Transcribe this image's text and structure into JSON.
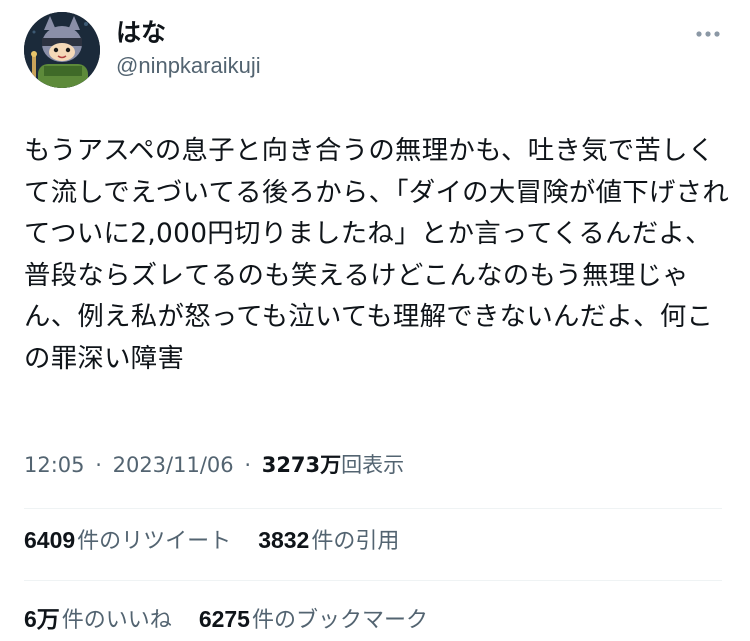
{
  "user": {
    "display_name": "はな",
    "handle": "@ninpkaraikuji",
    "avatar_icon": "cartoon-cat-ninja-avatar"
  },
  "more_icon": "ellipsis-icon",
  "tweet": {
    "text": "もうアスペの息子と向き合うの無理かも、吐き気で苦しくて流しでえづいてる後ろから、「ダイの大冒険が値下げされてついに2,000円切りましたね」とか言ってくるんだよ、普段ならズレてるのも笑えるけどこんなのもう無理じゃん、例え私が怒っても泣いても理解できないんだよ、何この罪深い障害"
  },
  "meta": {
    "time": "12:05",
    "separator": "·",
    "date": "2023/11/06",
    "views_count": "3273万",
    "views_label": "回表示"
  },
  "stats": {
    "retweets_count": "6409",
    "retweets_label": "件のリツイート",
    "quotes_count": "3832",
    "quotes_label": "件の引用",
    "likes_count": "6万",
    "likes_label": "件のいいね",
    "bookmarks_count": "6275",
    "bookmarks_label": "件のブックマーク"
  },
  "colors": {
    "text_primary": "#0f1419",
    "text_secondary": "#536471",
    "divider": "#eff3f4",
    "background": "#ffffff"
  }
}
